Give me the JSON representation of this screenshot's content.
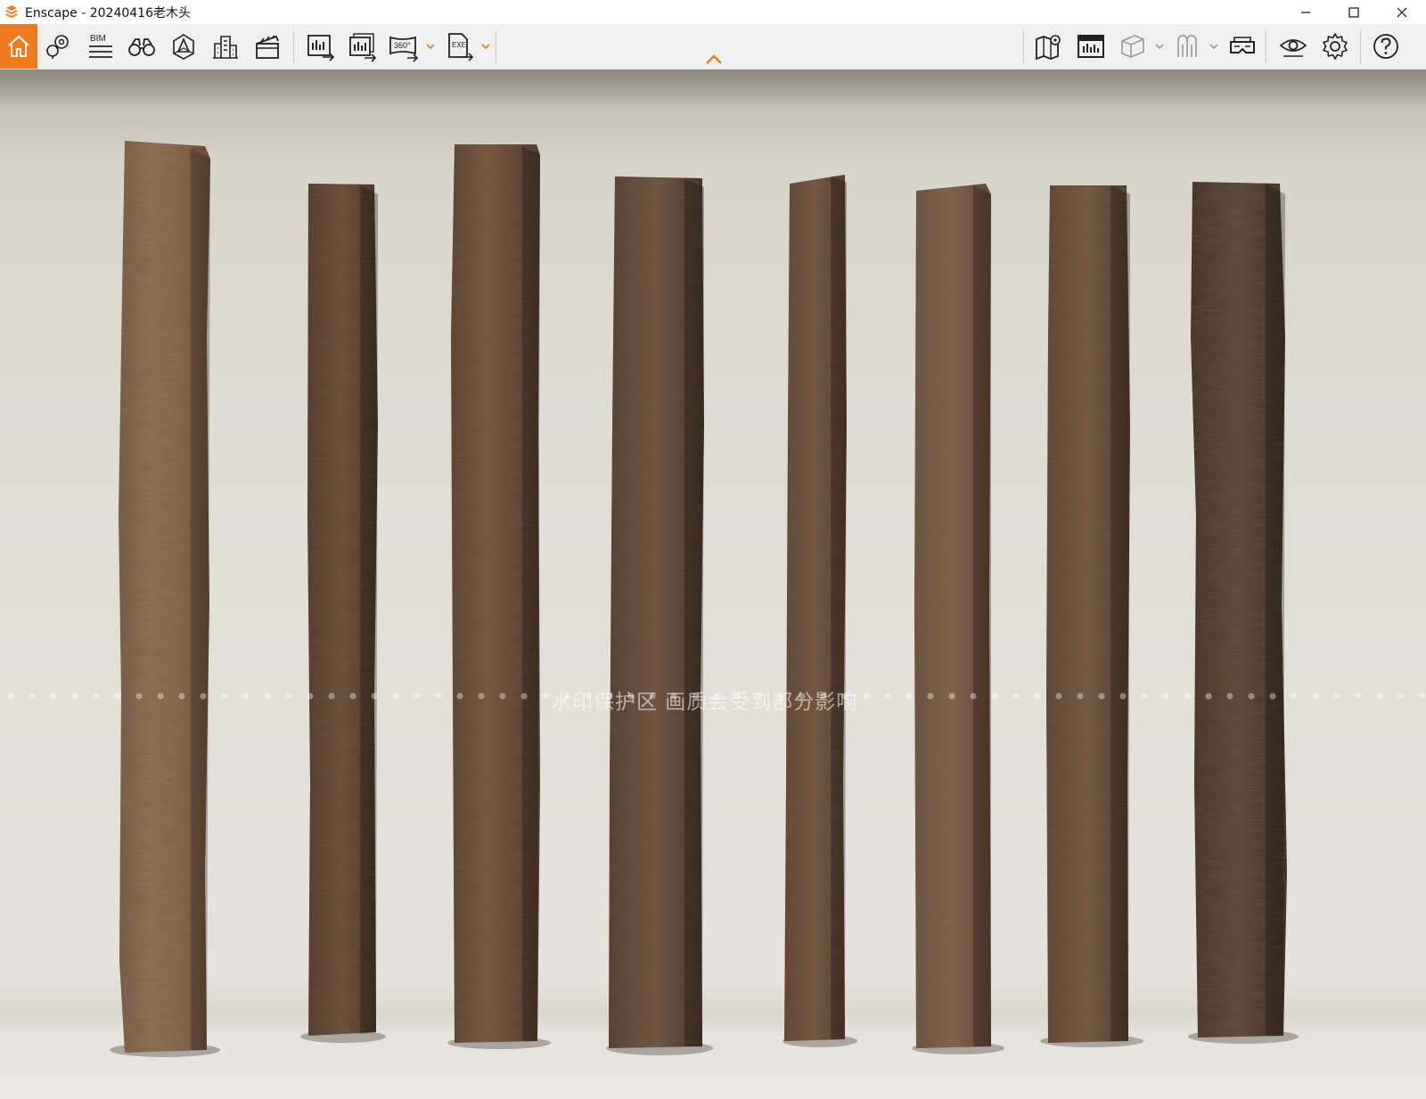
{
  "window": {
    "title": "Enscape - 20240416老木头",
    "controls": [
      "minimize-icon",
      "maximize-icon",
      "close-icon"
    ]
  },
  "toolbar": {
    "bim_label": "BIM",
    "pano_label": "360°",
    "exe_label": "EXE",
    "accent_color": "#f07a1f",
    "left_tools": [
      "home-icon",
      "location-pin-icon",
      "bim-list-icon",
      "binoculars-icon",
      "asset-library-icon",
      "buildings-icon",
      "clapperboard-icon",
      "render-image-icon",
      "batch-render-icon",
      "panorama-360-icon",
      "export-exe-icon"
    ],
    "right_tools": [
      "map-icon",
      "bim-viewer-icon",
      "cube-view-icon",
      "walk-mode-icon",
      "vr-headset-icon",
      "visual-settings-eye-icon",
      "gear-icon",
      "help-icon"
    ]
  },
  "viewport": {
    "scene": "eight weathered wooden planks standing against a wall",
    "watermark_text": "水印保护区  画质会受到部分影响",
    "colors": {
      "wall": "#e1ded6",
      "wood": "#6a4a33"
    }
  }
}
